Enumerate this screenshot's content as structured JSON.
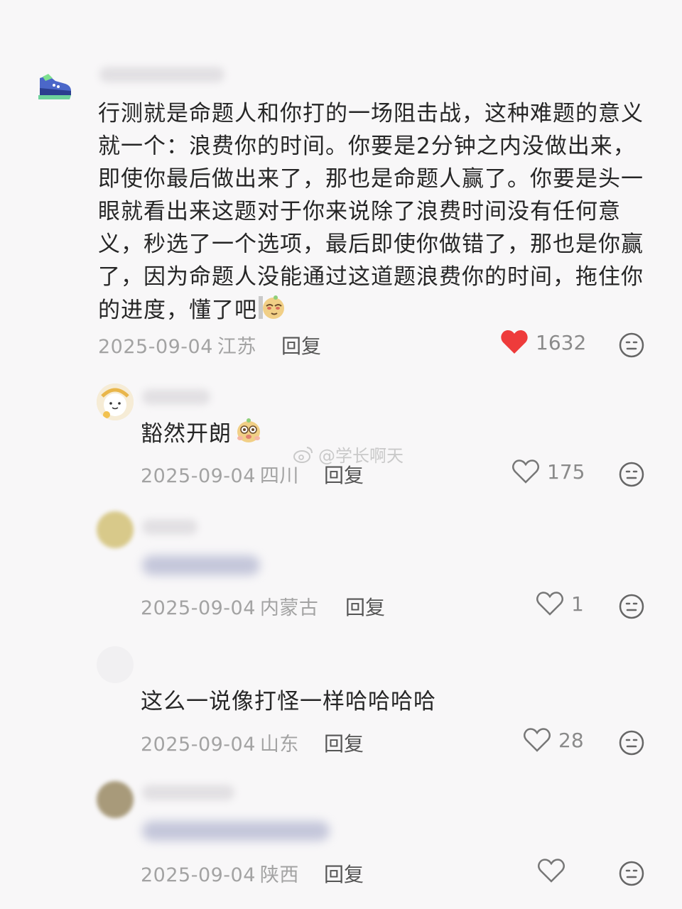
{
  "comments": [
    {
      "text": "行测就是命题人和你打的一场阻击战，这种难题的意义就一个：浪费你的时间。你要是2分钟之内没做出来，即使你最后做出来了，那也是命题人赢了。你要是头一眼就看出来这题对于你来说除了浪费时间没有任何意义，秒选了一个选项，最后即使你做错了，那也是你赢了，因为命题人没能通过这道题浪费你的时间，拖住你的进度，懂了吧",
      "date": "2025-09-04",
      "location": "江苏",
      "reply_label": "回复",
      "likes": "1632",
      "liked": true,
      "avatar_icon": "sneaker-icon"
    },
    {
      "text": "豁然开朗",
      "date": "2025-09-04",
      "location": "四川",
      "reply_label": "回复",
      "likes": "175",
      "liked": false,
      "avatar_icon": "bear-avatar"
    },
    {
      "text": "",
      "date": "2025-09-04",
      "location": "内蒙古",
      "reply_label": "回复",
      "likes": "1",
      "liked": false,
      "avatar_icon": "blurred-avatar"
    },
    {
      "text": "这么一说像打怪一样哈哈哈哈",
      "date": "2025-09-04",
      "location": "山东",
      "reply_label": "回复",
      "likes": "28",
      "liked": false,
      "avatar_icon": "blank-avatar"
    },
    {
      "text": "",
      "date": "2025-09-04",
      "location": "陕西",
      "reply_label": "回复",
      "likes": "",
      "liked": false,
      "avatar_icon": "blurred-avatar"
    }
  ],
  "watermark": {
    "text": "@学长啊天",
    "icon": "weibo-icon"
  },
  "colors": {
    "liked_heart": "#ee3b3b",
    "muted_text": "#a3a3a3",
    "background": "#f8f7f8"
  },
  "icons": {
    "like": "heart-icon",
    "emoji_button": "face-icon"
  }
}
